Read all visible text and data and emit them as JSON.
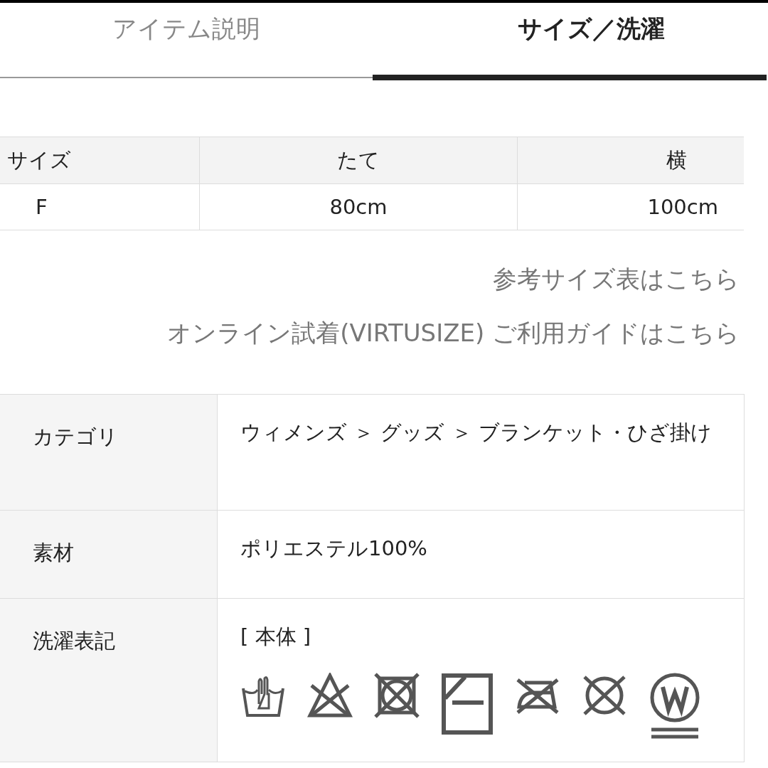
{
  "tabs": [
    {
      "label": "アイテム説明",
      "selected": false
    },
    {
      "label": "サイズ／洗濯",
      "selected": true
    }
  ],
  "size_table": {
    "columns": [
      "サイズ",
      "たて",
      "横"
    ],
    "rows": [
      [
        "F",
        "80cm",
        "100cm"
      ]
    ]
  },
  "links": [
    "参考サイズ表はこちら",
    "オンライン試着(VIRTUSIZE) ご利用ガイドはこちら"
  ],
  "details": [
    {
      "label": "カテゴリ",
      "value": "ウィメンズ ＞ グッズ ＞ ブランケット・ひざ掛け"
    },
    {
      "label": "素材",
      "value": "ポリエステル100%"
    },
    {
      "label": "洗濯表記",
      "value": "[ 本体 ]",
      "care_symbols": [
        {
          "kind": "hand-wash"
        },
        {
          "kind": "no-bleach"
        },
        {
          "kind": "no-tumble-dry"
        },
        {
          "kind": "shade-dry"
        },
        {
          "kind": "no-iron"
        },
        {
          "kind": "no-dry-clean"
        },
        {
          "kind": "wet-clean"
        }
      ]
    }
  ]
}
